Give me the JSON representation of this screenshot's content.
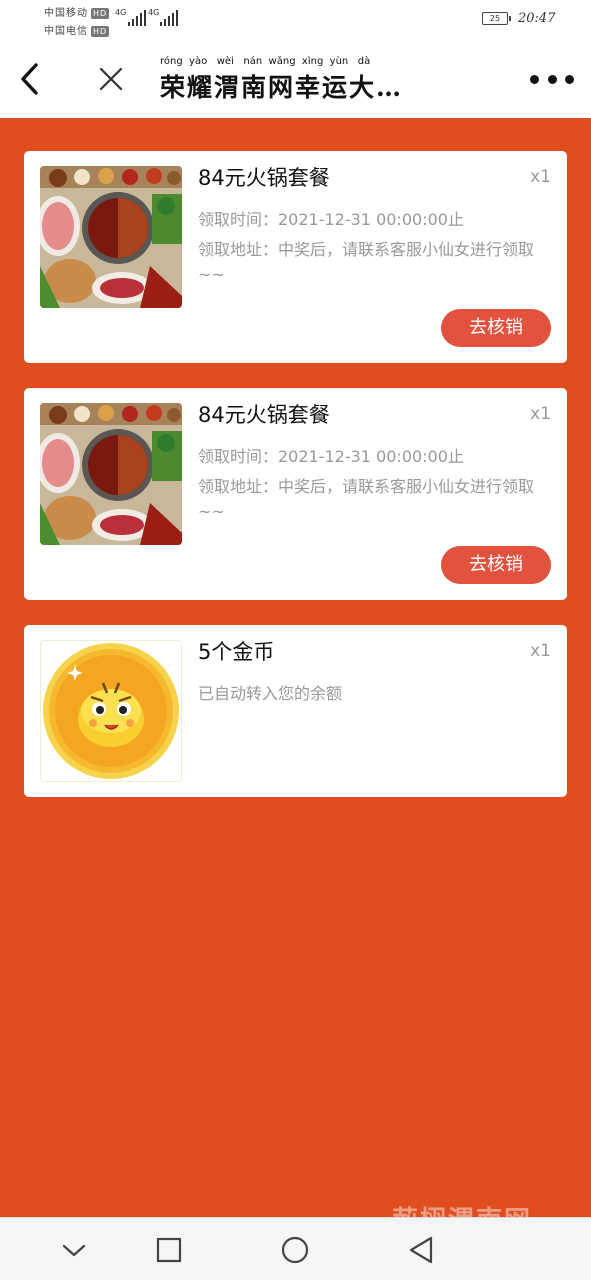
{
  "status_bar": {
    "carrier1": "中国移动",
    "carrier2": "中国电信",
    "hd": "HD",
    "network1": "4G",
    "network2": "4G",
    "battery": "25",
    "time": "20:47"
  },
  "nav": {
    "pinyin": "róng  yào   wèi   nán  wǎng  xìng  yùn   dà",
    "title": "荣耀渭南网幸运大…"
  },
  "prizes": [
    {
      "title": "84元火锅套餐",
      "qty": "x1",
      "time": "领取时间：2021-12-31 00:00:00止",
      "address": "领取地址：中奖后，请联系客服小仙女进行领取~~",
      "button": "去核销"
    },
    {
      "title": "84元火锅套餐",
      "qty": "x1",
      "time": "领取时间：2021-12-31 00:00:00止",
      "address": "领取地址：中奖后，请联系客服小仙女进行领取~~",
      "button": "去核销"
    },
    {
      "title": "5个金币",
      "qty": "x1",
      "note": "已自动转入您的余额"
    }
  ],
  "colors": {
    "background": "#e04e1f",
    "button": "#e3523f"
  },
  "icons": [
    "back-arrow-icon",
    "close-icon",
    "more-icon",
    "nav-back-icon",
    "nav-home-icon",
    "nav-recent-icon",
    "collapse-icon"
  ]
}
